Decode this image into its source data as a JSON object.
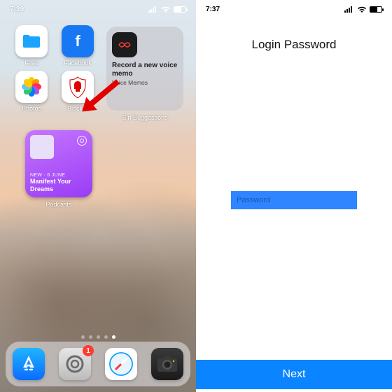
{
  "left": {
    "status": {
      "time": "7:39"
    },
    "apps": [
      {
        "name": "files",
        "label": "Files"
      },
      {
        "name": "facebook",
        "label": "Facebook"
      },
      {
        "name": "photos",
        "label": "Photos"
      },
      {
        "name": "blocker",
        "label": "Blocker"
      }
    ],
    "siri": {
      "title": "Record a new voice memo",
      "subtitle": "Voice Memos",
      "label": "Siri Suggestions"
    },
    "podcast": {
      "meta": "NEW · 6 JUNE",
      "title": "Manifest Your Dreams",
      "label": "Podcasts"
    },
    "dock": {
      "settings_badge": "1"
    }
  },
  "right": {
    "status": {
      "time": "7:37"
    },
    "title": "Login Password",
    "password_placeholder": "Password",
    "next_label": "Next"
  }
}
